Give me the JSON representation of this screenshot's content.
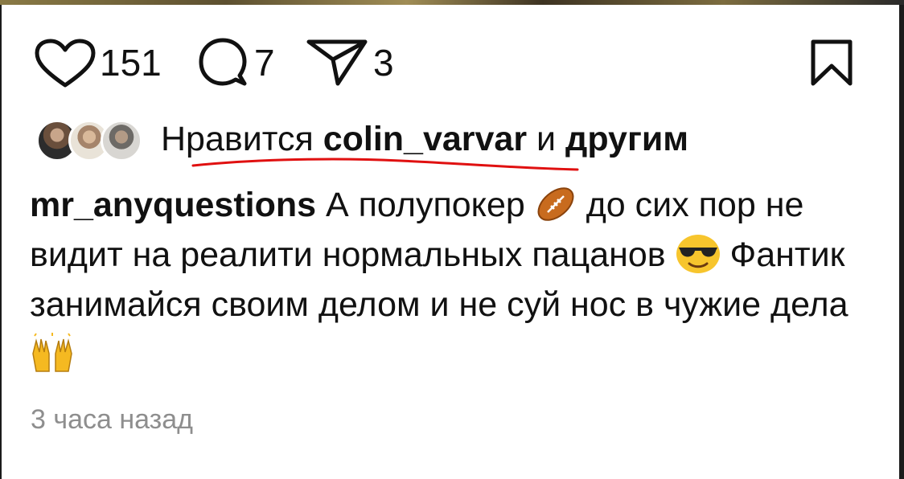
{
  "actions": {
    "likes_count": "151",
    "comments_count": "7",
    "shares_count": "3"
  },
  "liked_by": {
    "prefix": "Нравится",
    "user": "colin_varvar",
    "conjunction": "и",
    "others": "другим"
  },
  "caption": {
    "username": "mr_anyquestions",
    "part1": "А  полупокер",
    "emoji1": "american-football-emoji",
    "part2": "до сих пор не видит на реалити нормальных пацанов",
    "emoji2": "sunglasses-face-emoji",
    "part3": "Фантик занимайся своим делом и не суй нос в чужие дела",
    "emoji3": "raising-hands-emoji"
  },
  "timestamp": "3 часа назад",
  "colors": {
    "text": "#111111",
    "timestamp": "#8e8e8e",
    "annotation_underline": "#e01010"
  }
}
